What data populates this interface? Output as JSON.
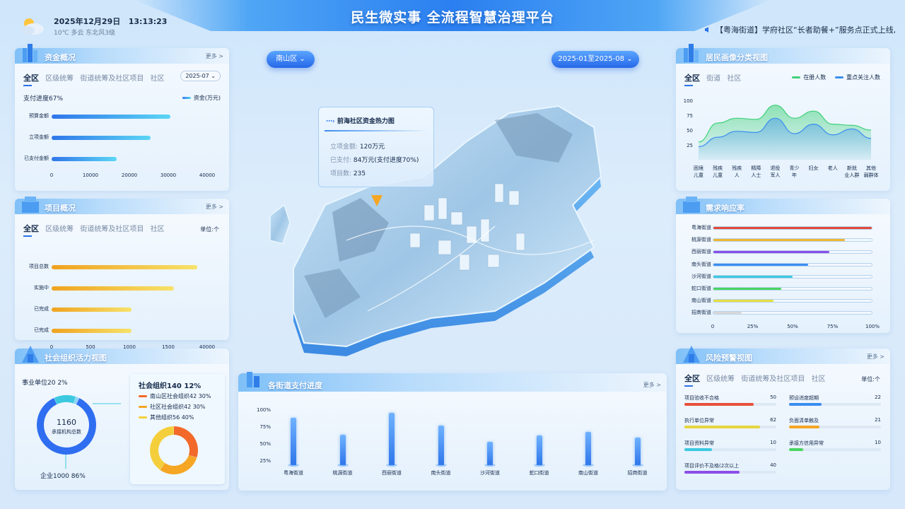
{
  "header": {
    "title": "民生微实事 全流程智慧治理平台",
    "date": "2025年12月29日",
    "time": "13:13:23",
    "weather": "10℃  多云  东北风3级",
    "ticker": "【粤海街道】学府社区“长者助餐+”服务点正式上线,"
  },
  "map_controls": {
    "district": "南山区",
    "date_range": "2025-01至2025-08"
  },
  "map_tooltip": {
    "title": "前海社区资金热力图",
    "rows": [
      {
        "label": "立项金额:",
        "value": "120万元"
      },
      {
        "label": "已支付:",
        "value": "84万元(支付进度70%)"
      },
      {
        "label": "项目数:",
        "value": "235"
      }
    ]
  },
  "funds": {
    "title": "资金概况",
    "more": "更多 >",
    "tabs": [
      "全区",
      "区级统筹",
      "街道统筹及社区项目",
      "社区"
    ],
    "month": "2025-07 ⌄",
    "progress_label": "支付进度67%",
    "legend": "资金(万元)",
    "chart_data": {
      "type": "bar",
      "orientation": "horizontal",
      "categories": [
        "预算金额",
        "立项金额",
        "已支付金额"
      ],
      "values": [
        30500,
        25500,
        16800
      ],
      "xlim": [
        0,
        40000
      ],
      "ticks": [
        "0",
        "10000",
        "20000",
        "30000",
        "40000"
      ]
    }
  },
  "projects": {
    "title": "项目概况",
    "more": "更多 >",
    "tabs": [
      "全区",
      "区级统筹",
      "街道统筹及社区项目",
      "社区"
    ],
    "unit": "单位:个",
    "chart_data": {
      "type": "bar",
      "orientation": "horizontal",
      "categories": [
        "项目总数",
        "实施中",
        "已完成",
        "已完成"
      ],
      "values": [
        1640,
        1380,
        900,
        900
      ],
      "ticks": [
        "0",
        "500",
        "1000",
        "1500",
        "40000"
      ]
    }
  },
  "orgs": {
    "title": "社会组织活力视图",
    "total_value": "1160",
    "total_label": "承接机构总数",
    "label_public": "事业单位20 2%",
    "label_enterprise": "企业1000 86%",
    "social_title": "社会组织140 12%",
    "social_items": [
      {
        "label": "南山区社会组织42 30%",
        "color": "#f2692a"
      },
      {
        "label": "社区社会组织42 30%",
        "color": "#f5a623"
      },
      {
        "label": "其他组织56 40%",
        "color": "#f4cf3b"
      }
    ],
    "chart_data": [
      {
        "type": "pie",
        "categories": [
          "企业",
          "社会组织",
          "事业单位"
        ],
        "values": [
          86,
          12,
          2
        ]
      },
      {
        "type": "pie",
        "categories": [
          "南山区社会组织",
          "社区社会组织",
          "其他组织"
        ],
        "values": [
          30,
          30,
          40
        ]
      }
    ]
  },
  "streets": {
    "title": "各街道支付进度",
    "more": "更多 >",
    "yticks": [
      "100%",
      "75%",
      "50%",
      "25%"
    ],
    "chart_data": {
      "type": "bar",
      "categories": [
        "粤海街道",
        "桃源街道",
        "西丽街道",
        "南头街道",
        "沙河街道",
        "蛇口街道",
        "南山街道",
        "招商街道"
      ],
      "values": [
        89,
        64,
        96,
        77,
        53,
        62,
        68,
        59
      ],
      "ylim": [
        25,
        100
      ]
    }
  },
  "residents": {
    "title": "居民画像分类视图",
    "tabs": [
      "全区",
      "街道",
      "社区"
    ],
    "legend": [
      {
        "label": "在册人数",
        "color": "#3fd17a"
      },
      {
        "label": "重点关注人数",
        "color": "#3a8df0"
      }
    ],
    "chart_data": {
      "type": "area",
      "categories": [
        "困境儿童",
        "残疾儿童",
        "残疾人",
        "精障人士",
        "退役军人",
        "青少年",
        "妇女",
        "老人",
        "新就业人群",
        "其他弱群体"
      ],
      "series": [
        {
          "name": "在册人数",
          "values": [
            30,
            62,
            70,
            68,
            92,
            70,
            82,
            60,
            58,
            50
          ]
        },
        {
          "name": "重点关注人数",
          "values": [
            22,
            38,
            48,
            46,
            70,
            44,
            60,
            42,
            52,
            36
          ]
        }
      ],
      "ylim": [
        0,
        100
      ],
      "yticks": [
        "100",
        "75",
        "50",
        "25"
      ]
    }
  },
  "response": {
    "title": "需求响应率",
    "xticks": [
      "0",
      "25%",
      "50%",
      "75%",
      "100%"
    ],
    "chart_data": {
      "type": "bar",
      "orientation": "horizontal",
      "categories": [
        "粤海街道",
        "桃源街道",
        "西丽街道",
        "南头街道",
        "沙河街道",
        "蛇口街道",
        "南山街道",
        "招商街道"
      ],
      "values": [
        100,
        83,
        73,
        60,
        50,
        43,
        38,
        18
      ],
      "colors": [
        "#e24a3b",
        "#f0b631",
        "#8a4fe8",
        "#3b8ef0",
        "#3cc9e0",
        "#49d461",
        "#e8e040",
        "#d8d8d8"
      ],
      "xlim": [
        0,
        100
      ]
    }
  },
  "risk": {
    "title": "风险预警视图",
    "more": "更多 >",
    "tabs": [
      "全区",
      "区级统筹",
      "街道统筹及社区项目",
      "社区"
    ],
    "unit": "单位:个",
    "items": [
      {
        "label": "项目验收不合格",
        "value": "50",
        "pct": 0.75,
        "color": "#e8503a"
      },
      {
        "label": "预设进度超期",
        "value": "22",
        "pct": 0.35,
        "color": "#3a8df0"
      },
      {
        "label": "执行单位异常",
        "value": "62",
        "pct": 0.82,
        "color": "#e6d640"
      },
      {
        "label": "负面清单触及",
        "value": "21",
        "pct": 0.33,
        "color": "#f5a623"
      },
      {
        "label": "项目资料异常",
        "value": "10",
        "pct": 0.3,
        "color": "#3cc9e0"
      },
      {
        "label": "承接方信用异常",
        "value": "10",
        "pct": 0.15,
        "color": "#49d461"
      },
      {
        "label": "项目评价不及格(2次以上",
        "value": "40",
        "pct": 0.6,
        "color": "#8a4fe8"
      }
    ]
  }
}
